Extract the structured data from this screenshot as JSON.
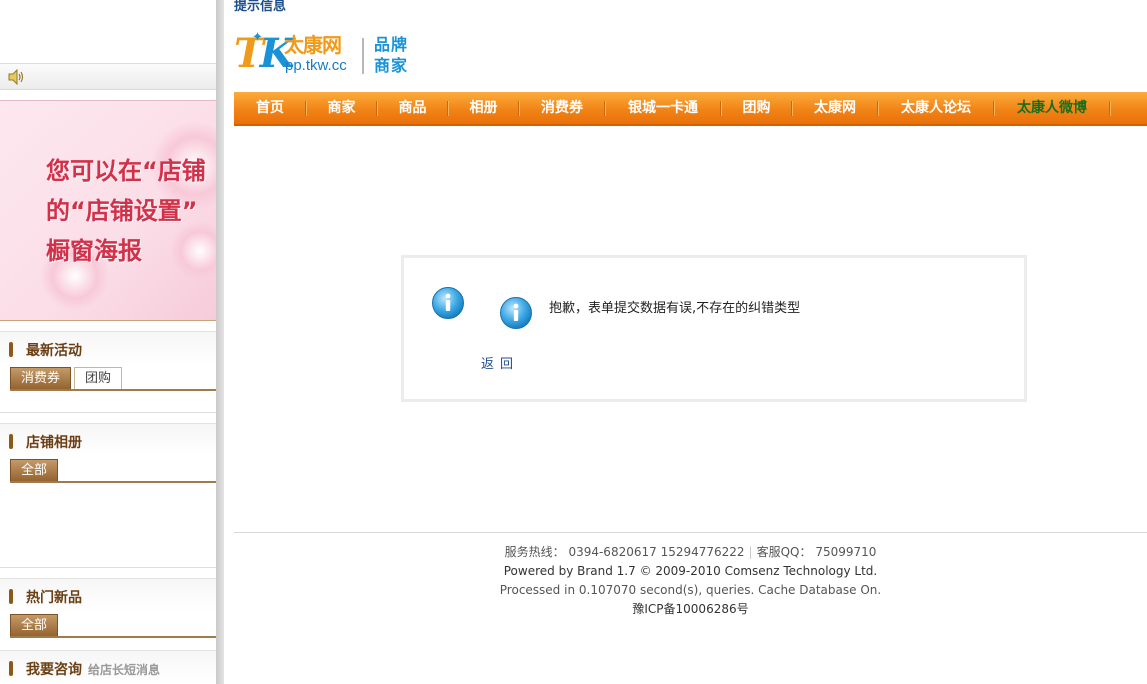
{
  "background_page": {
    "banner_text_lines": [
      "您可以在“店铺",
      "的“店铺设置”",
      "橱窗海报"
    ],
    "sections": [
      {
        "title": "最新活动",
        "tabs": [
          "消费券",
          "团购"
        ]
      },
      {
        "title": "店铺相册",
        "tabs": [
          "全部"
        ]
      },
      {
        "title": "热门新品",
        "tabs": [
          "全部"
        ]
      },
      {
        "title": "我要咨询",
        "subtitle": "给店长短消息"
      }
    ]
  },
  "dialog": {
    "title": "提示信息",
    "logo": {
      "mark_t": "T",
      "mark_k": "K",
      "name": "太康网",
      "url": "pp.tkw.cc",
      "brand_line1": "品牌",
      "brand_line2": "商家"
    },
    "nav": [
      "首页",
      "商家",
      "商品",
      "相册",
      "消费券",
      "银城一卡通",
      "团购",
      "太康网",
      "太康人论坛",
      "太康人微博"
    ],
    "message": "抱歉，表单提交数据有误,不存在的纠错类型",
    "back_link": "返回",
    "footer": {
      "hotline_label": "服务热线：",
      "hotline_numbers": "0394-6820617 15294776222",
      "qq_label": "客服QQ：",
      "qq_number": "75099710",
      "powered": "Powered by Brand 1.7 © 2009-2010 Comsenz Technology Ltd.",
      "processed": "Processed in 0.107070 second(s), queries. Cache Database On.",
      "icp": "豫ICP备10006286号"
    }
  },
  "colors": {
    "nav_orange": "#f28417",
    "link_blue": "#1f4f8f",
    "tab_brown": "#946330",
    "weibo_green": "#1a6e1a"
  }
}
